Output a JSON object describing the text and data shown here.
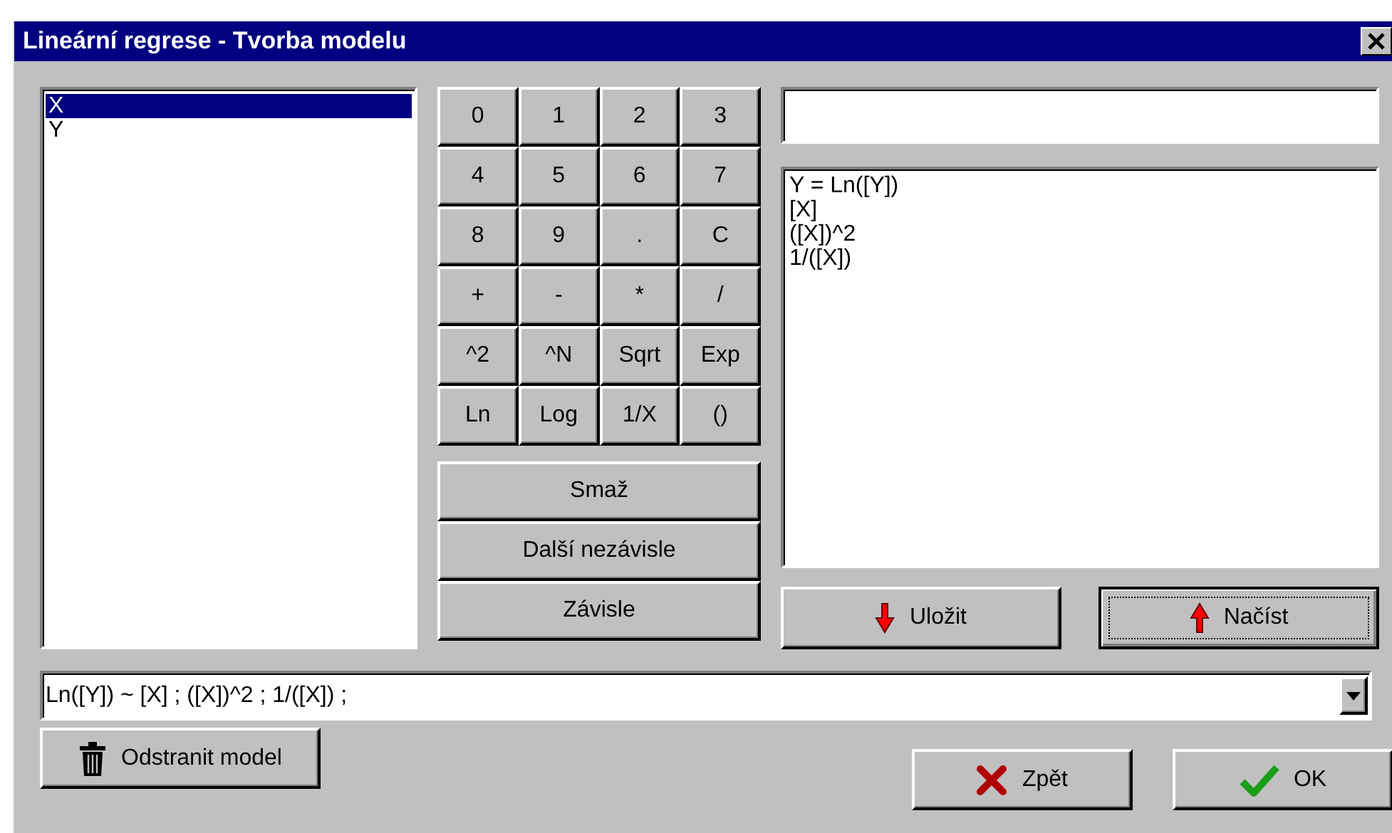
{
  "window": {
    "title": "Lineární regrese - Tvorba modelu"
  },
  "variables": [
    {
      "label": "X",
      "selected": true
    },
    {
      "label": "Y",
      "selected": false
    }
  ],
  "keypad": [
    "0",
    "1",
    "2",
    "3",
    "4",
    "5",
    "6",
    "7",
    "8",
    "9",
    ".",
    "C",
    "+",
    "-",
    "*",
    "/",
    "^2",
    "^N",
    "Sqrt",
    "Exp",
    "Ln",
    "Log",
    "1/X",
    "()"
  ],
  "actions": [
    "Smaž",
    "Další nezávisle",
    "Závisle"
  ],
  "model_lines": [
    "Y = Ln([Y])",
    "[X]",
    "([X])^2",
    "1/([X])"
  ],
  "file_buttons": [
    {
      "kind": "save",
      "label": "Uložit",
      "focused": false
    },
    {
      "kind": "load",
      "label": "Načíst",
      "focused": true
    }
  ],
  "model_combo": {
    "value": "Ln([Y]) ~ [X] ; ([X])^2 ; 1/([X]) ;"
  },
  "remove_button": {
    "label": "Odstranit model"
  },
  "dialog_buttons": [
    {
      "kind": "cancel",
      "label": "Zpět"
    },
    {
      "kind": "ok",
      "label": "OK"
    }
  ]
}
